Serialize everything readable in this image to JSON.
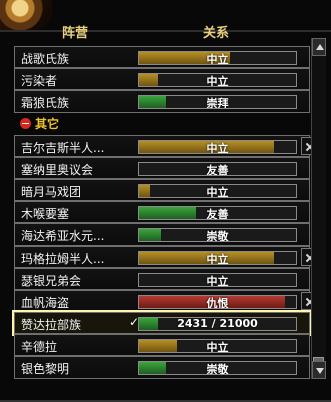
{
  "header": {
    "faction": "阵营",
    "relation": "关系"
  },
  "rows": [
    {
      "name": "战歌氏族",
      "relation": "中立",
      "fill": 0.58,
      "color": "yellow"
    },
    {
      "name": "污染者",
      "relation": "中立",
      "fill": 0.12,
      "color": "yellow"
    },
    {
      "name": "霜狼氏族",
      "relation": "崇拜",
      "fill": 0.17,
      "color": "green"
    },
    {
      "section": "其它"
    },
    {
      "name": "吉尔吉斯半人...",
      "relation": "中立",
      "fill": 0.86,
      "color": "yellow",
      "icon": "crossed-swords-icon"
    },
    {
      "name": "塞纳里奥议会",
      "relation": "友善",
      "fill": 0.0,
      "color": "green"
    },
    {
      "name": "暗月马戏团",
      "relation": "中立",
      "fill": 0.07,
      "color": "yellow"
    },
    {
      "name": "木喉要塞",
      "relation": "友善",
      "fill": 0.36,
      "color": "green"
    },
    {
      "name": "海达希亚水元...",
      "relation": "崇敬",
      "fill": 0.14,
      "color": "green"
    },
    {
      "name": "玛格拉姆半人...",
      "relation": "中立",
      "fill": 0.86,
      "color": "yellow",
      "icon": "crossed-swords-icon"
    },
    {
      "name": "瑟银兄弟会",
      "relation": "中立",
      "fill": 0.0,
      "color": "yellow"
    },
    {
      "name": "血帆海盗",
      "relation": "仇恨",
      "fill": 0.93,
      "color": "red",
      "icon": "crossed-swords-icon"
    },
    {
      "name": "赞达拉部族",
      "relation": "2431 / 21000",
      "fill": 0.12,
      "color": "green",
      "highlight": true,
      "check": "✓"
    },
    {
      "name": "辛德拉",
      "relation": "中立",
      "fill": 0.24,
      "color": "yellow"
    },
    {
      "name": "银色黎明",
      "relation": "崇敬",
      "fill": 0.17,
      "color": "green"
    }
  ]
}
